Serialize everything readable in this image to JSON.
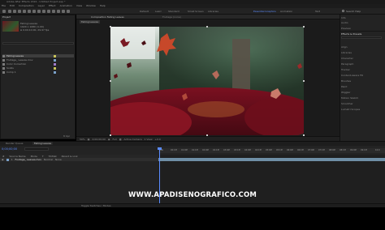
{
  "window": {
    "title": "Adobe After Effects 2022 - Untitled Project.aep *"
  },
  "menu": [
    "File",
    "Edit",
    "Composition",
    "Layer",
    "Effect",
    "Animation",
    "View",
    "Window",
    "Help"
  ],
  "toolbar": {
    "workspaces": [
      "Default",
      "Learn",
      "Standard",
      "Small Screen",
      "Libraries",
      "Essential Graphics",
      "Animation",
      "Text"
    ],
    "active_workspace": "Essential Graphics",
    "search_label": "Search Help"
  },
  "project_panel": {
    "title": "Project",
    "file_info": [
      "Falling Leaves",
      "1920 x 1080 (1.00)",
      "Δ 0;00;10;00, 29.97 fps"
    ],
    "items": [
      {
        "name": "Falling Leaves",
        "selected": true
      },
      {
        "name": "Footage_ Leaves.mov",
        "selected": false
      },
      {
        "name": "Color Correction",
        "selected": false
      },
      {
        "name": "Solids",
        "selected": false
      },
      {
        "name": "Comp 1",
        "selected": false
      }
    ],
    "bpc": "8 bpc"
  },
  "viewer": {
    "tabs": [
      "Composition Falling Leaves",
      "Footage (none)"
    ],
    "breadcrumb": "Falling Leaves",
    "zoom": "50%",
    "resolution": "Full",
    "timecode": "0;00;00;00",
    "camera": "Active Camera",
    "views": "1 View",
    "exposure": "+0.0"
  },
  "right_panel": {
    "items": [
      "Info",
      "Audio",
      "Preview",
      "Effects & Presets",
      "Align",
      "Libraries",
      "Character",
      "Paragraph",
      "Tracker",
      "Content-Aware Fill",
      "Brushes",
      "Paint",
      "Wiggler",
      "Motion Sketch",
      "Smoother",
      "Lumetri Scopes"
    ],
    "header_index": 3
  },
  "timeline": {
    "tabs": [
      "Render Queue",
      "Falling Leaves"
    ],
    "timecode": "0;00;00;00",
    "column_headers": [
      "#",
      "Source Name",
      "Mode",
      "T",
      "TrkMat",
      "Parent & Link"
    ],
    "layers": [
      {
        "index": "1",
        "name": "Footage_ Leaves.mov",
        "mode": "Normal",
        "parent": "None"
      }
    ],
    "ruler_labels": [
      "00s",
      "00:15f",
      "01:00f",
      "01:15f",
      "02:00f",
      "02:15f",
      "03:00f",
      "03:15f",
      "04:00f",
      "04:15f",
      "05:00f",
      "05:15f",
      "06:00f",
      "06:15f",
      "07:00f",
      "07:15f",
      "08:00f",
      "08:15f",
      "09:00f",
      "09:15f",
      "10:0"
    ],
    "footer": "Toggle Switches / Modes"
  },
  "watermark": "WWW.APADISENOGRAFICO.COM",
  "colors": {
    "accent": "#5b8cff",
    "panel": "#232323",
    "layer_bar": "#6f8fa6"
  }
}
